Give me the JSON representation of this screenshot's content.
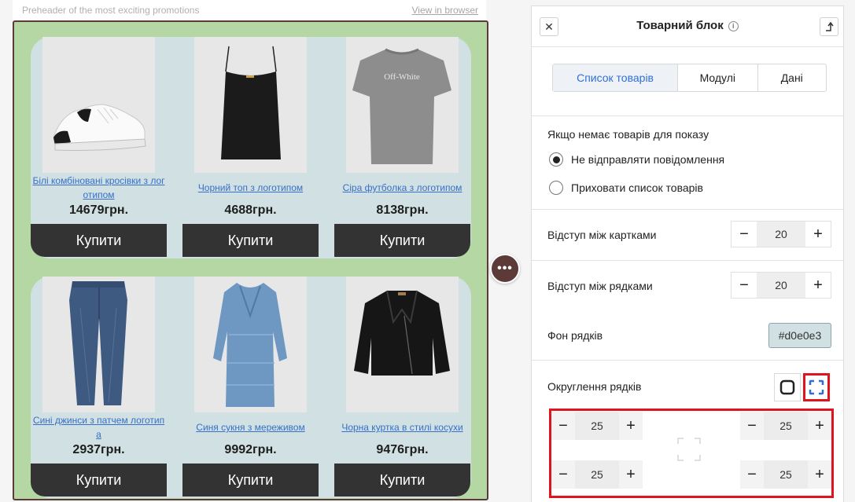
{
  "preheader": {
    "text": "Preheader of the most exciting promotions",
    "view_in_browser": "View in browser"
  },
  "products": [
    {
      "name": "Білі комбіновані кросівки з лог отипом",
      "price": "14679грн.",
      "buy": "Купити",
      "image": "sneaker-image"
    },
    {
      "name": "Чорний топ з логотипом",
      "price": "4688грн.",
      "buy": "Купити",
      "image": "top-image"
    },
    {
      "name": "Сіра футболка з логотипом",
      "price": "8138грн.",
      "buy": "Купити",
      "image": "tshirt-image"
    },
    {
      "name": "Сині джинси з патчем логотип а",
      "price": "2937грн.",
      "buy": "Купити",
      "image": "jeans-image"
    },
    {
      "name": "Синя сукня з мереживом",
      "price": "9992грн.",
      "buy": "Купити",
      "image": "dress-image"
    },
    {
      "name": "Чорна куртка в стилі косухи",
      "price": "9476грн.",
      "buy": "Купити",
      "image": "jacket-image"
    }
  ],
  "tshirt_print": "Off-White",
  "dots_label": "•••",
  "panel": {
    "title": "Товарний блок",
    "info": "i",
    "close": "✕",
    "tabs": [
      "Список товарів",
      "Модулі",
      "Дані"
    ],
    "active_tab": "Список товарів",
    "empty_label": "Якщо немає товарів для показу",
    "radio_options": [
      "Не відправляти повідомлення",
      "Приховати список товарів"
    ],
    "radio_selected": 0,
    "card_spacing_label": "Відступ між картками",
    "card_spacing": "20",
    "row_spacing_label": "Відступ між рядками",
    "row_spacing": "20",
    "row_bg_label": "Фон рядків",
    "row_bg": "#d0e0e3",
    "rounding_label": "Округлення рядків",
    "corners": {
      "top_left": "25",
      "top_right": "25",
      "bottom_left": "25",
      "bottom_right": "25"
    },
    "minus": "−",
    "plus": "+"
  },
  "colors": {
    "block_bg": "#b5d7a4",
    "row_bg": "#d0e0e3",
    "button_bg": "#333333",
    "accent": "#2f6fd3",
    "highlight": "#e0141c",
    "dots_bg": "#5b3a38"
  }
}
